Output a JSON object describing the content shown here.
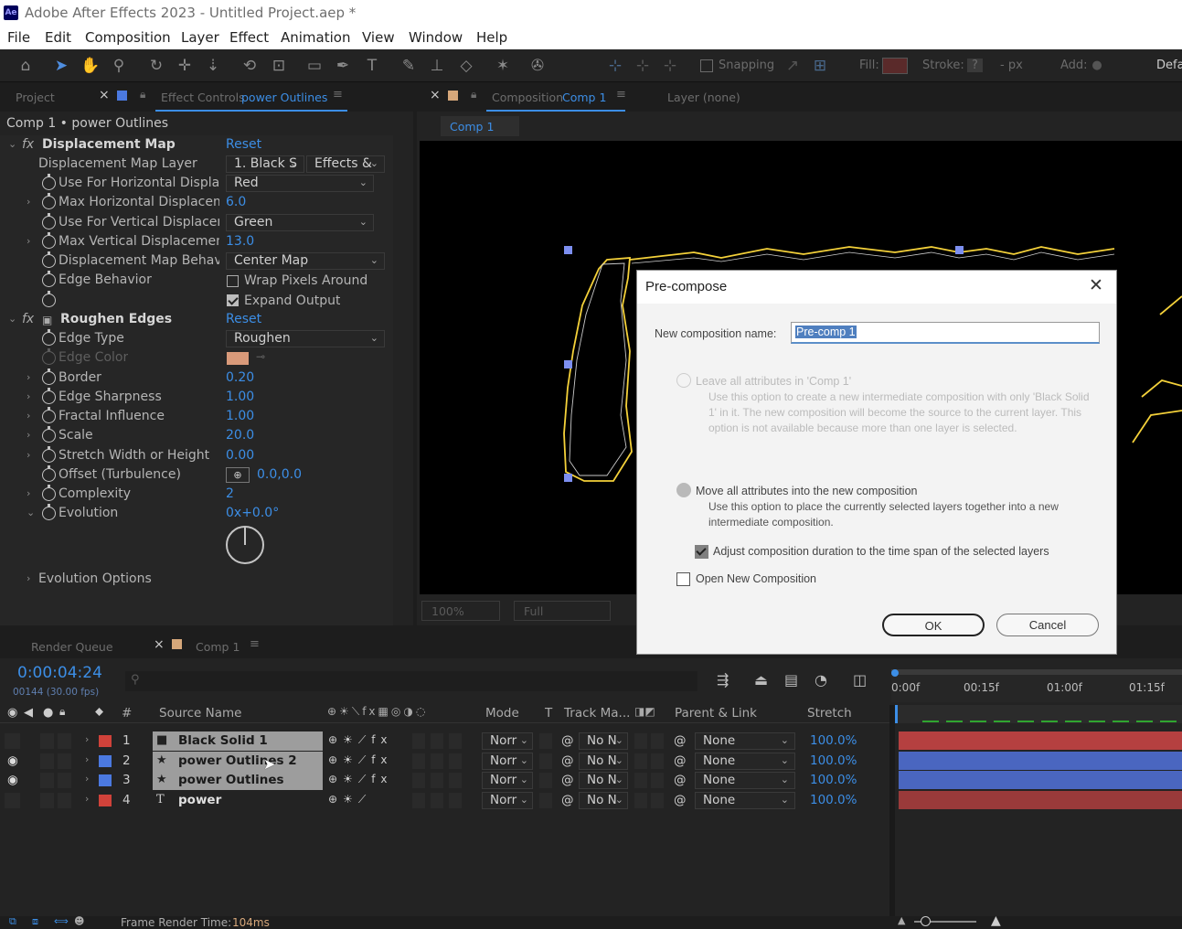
{
  "window": {
    "app_icon": "Ae",
    "title": "Adobe After Effects 2023 - Untitled Project.aep *"
  },
  "menu": [
    "File",
    "Edit",
    "Composition",
    "Layer",
    "Effect",
    "Animation",
    "View",
    "Window",
    "Help"
  ],
  "toolbar": {
    "snapping": "Snapping",
    "fill": "Fill:",
    "stroke": "Stroke:",
    "stroke_q": "?",
    "stroke_px": "- px",
    "add": "Add:",
    "workspace": "Defa"
  },
  "effect_panel": {
    "tab_project": "Project",
    "tab_effect_prefix": "Effect Controls",
    "tab_effect_layer": "power Outlines",
    "breadcrumb": "Comp 1 • power Outlines",
    "displacement": {
      "name": "Displacement Map",
      "reset": "Reset",
      "layer_label": "Displacement Map Layer",
      "layer_val": "1. Black S",
      "layer_src": "Effects &",
      "use_h_label": "Use For Horizontal Displace",
      "use_h_val": "Red",
      "max_h_label": "Max Horizontal Displaceme",
      "max_h_val": "6.0",
      "use_v_label": "Use For Vertical Displaceme",
      "use_v_val": "Green",
      "max_v_label": "Max Vertical Displacement",
      "max_v_val": "13.0",
      "behavior_label": "Displacement Map Behavio",
      "behavior_val": "Center Map",
      "edge_label": "Edge Behavior",
      "wrap_label": "Wrap Pixels Around",
      "expand_label": "Expand Output"
    },
    "roughen": {
      "name": "Roughen Edges",
      "reset": "Reset",
      "edge_type_label": "Edge Type",
      "edge_type_val": "Roughen",
      "edge_color_label": "Edge Color",
      "border_label": "Border",
      "border_val": "0.20",
      "sharp_label": "Edge Sharpness",
      "sharp_val": "1.00",
      "fractal_label": "Fractal Influence",
      "fractal_val": "1.00",
      "scale_label": "Scale",
      "scale_val": "20.0",
      "stretch_label": "Stretch Width or Height",
      "stretch_val": "0.00",
      "offset_label": "Offset (Turbulence)",
      "offset_val": "0.0,0.0",
      "complexity_label": "Complexity",
      "complexity_val": "2",
      "evolution_label": "Evolution",
      "evolution_val": "0x+0.0°",
      "evo_options_label": "Evolution Options"
    }
  },
  "comp_panel": {
    "tab_prefix": "Composition",
    "tab_name": "Comp 1",
    "layer_tab": "Layer (none)",
    "subtab": "Comp 1",
    "zoom": "100%",
    "res": "Full"
  },
  "dialog": {
    "title": "Pre-compose",
    "name_label": "New composition name:",
    "name_value": "Pre-comp 1",
    "opt1_label": "Leave all attributes in 'Comp 1'",
    "opt1_desc": "Use this option to create a new intermediate composition with only 'Black Solid 1' in it. The new composition will become the source to the current layer. This option is not available because more than one layer is selected.",
    "opt2_label": "Move all attributes into the new composition",
    "opt2_desc": "Use this option to place the currently selected layers together into a new intermediate composition.",
    "adjust_label": "Adjust composition duration to the time span of the selected layers",
    "open_label": "Open New Composition",
    "ok": "OK",
    "cancel": "Cancel"
  },
  "timeline": {
    "tab_render": "Render Queue",
    "tab_comp": "Comp 1",
    "timecode": "0:00:04:24",
    "frames": "00144 (30.00 fps)",
    "search_placeholder": "",
    "cols": {
      "hash": "#",
      "source": "Source Name",
      "mode": "Mode",
      "t": "T",
      "track": "Track Ma...",
      "parent": "Parent & Link",
      "stretch": "Stretch"
    },
    "ruler": [
      "0:00f",
      "00:15f",
      "01:00f",
      "01:15f"
    ],
    "layers": [
      {
        "num": "1",
        "name": "Black Solid 1",
        "mode": "Norr",
        "track": "No N",
        "parent": "None",
        "stretch": "100.0%",
        "label_color": "#d0423a",
        "bar_color": "#b54040"
      },
      {
        "num": "2",
        "name": "power Outlines 2",
        "mode": "Norr",
        "track": "No N",
        "parent": "None",
        "stretch": "100.0%",
        "label_color": "#4b79e0",
        "bar_color": "#4a66c0"
      },
      {
        "num": "3",
        "name": "power Outlines",
        "mode": "Norr",
        "track": "No N",
        "parent": "None",
        "stretch": "100.0%",
        "label_color": "#4b79e0",
        "bar_color": "#4a66c0"
      },
      {
        "num": "4",
        "name": "power",
        "mode": "Norr",
        "track": "No N",
        "parent": "None",
        "stretch": "100.0%",
        "label_color": "#d0423a",
        "bar_color": "#9a3a3a"
      }
    ],
    "render_time_label": "Frame Render Time:",
    "render_time_val": "104ms"
  }
}
